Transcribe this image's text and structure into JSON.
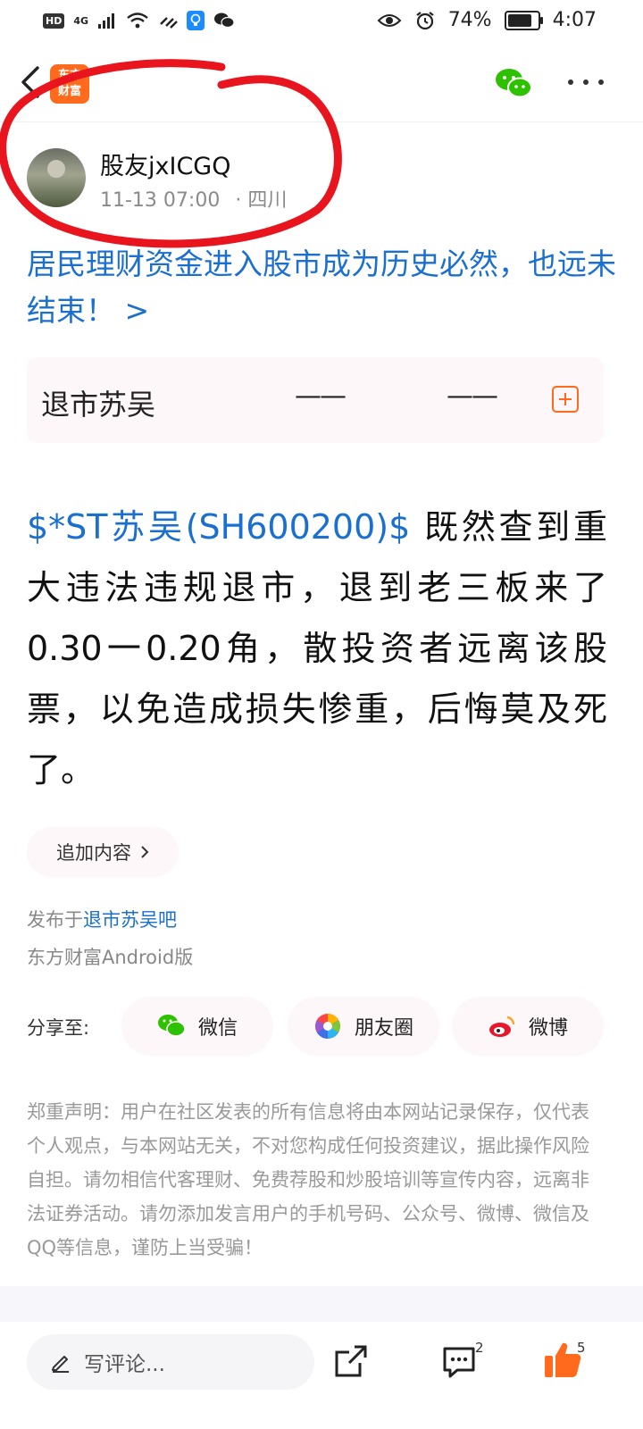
{
  "status_bar": {
    "hd": "HD",
    "network": "4G",
    "battery_percent": "74%",
    "time": "4:07"
  },
  "nav": {
    "logo_line1": "东方",
    "logo_line2": "财富"
  },
  "author": {
    "name": "股友jxICGQ",
    "time": "11-13 07:00",
    "location": "· 四川"
  },
  "headline": "居民理财资金进入股市成为历史必然，也远未结束！ >",
  "stock_card": {
    "name": "退市苏吴",
    "price": "——",
    "change": "——"
  },
  "post": {
    "stock_tag": "$*ST苏吴(SH600200)$",
    "text": " 既然查到重大违法违规退市，退到老三板来了0.30一0.20角，散投资者远离该股票，以免造成损失惨重，后悔莫及死了。"
  },
  "add_content_label": "追加内容",
  "published": {
    "prefix": "发布于",
    "forum": "退市苏吴吧"
  },
  "client": "东方财富Android版",
  "share": {
    "label": "分享至:",
    "wechat": "微信",
    "moments": "朋友圈",
    "weibo": "微博"
  },
  "disclaimer": "郑重声明：用户在社区发表的所有信息将由本网站记录保存，仅代表个人观点，与本网站无关，不对您构成任何投资建议，据此操作风险自担。请勿相信代客理财、免费荐股和炒股培训等宣传内容，远离非法证券活动。请勿添加发言用户的手机号码、公众号、微博、微信及QQ等信息，谨防上当受骗！",
  "bottom": {
    "comment_placeholder": "写评论...",
    "comment_count": "2",
    "like_count": "5"
  },
  "colors": {
    "accent": "#ff6a1c",
    "link": "#1a6fcf",
    "annotation": "#e8141e"
  }
}
